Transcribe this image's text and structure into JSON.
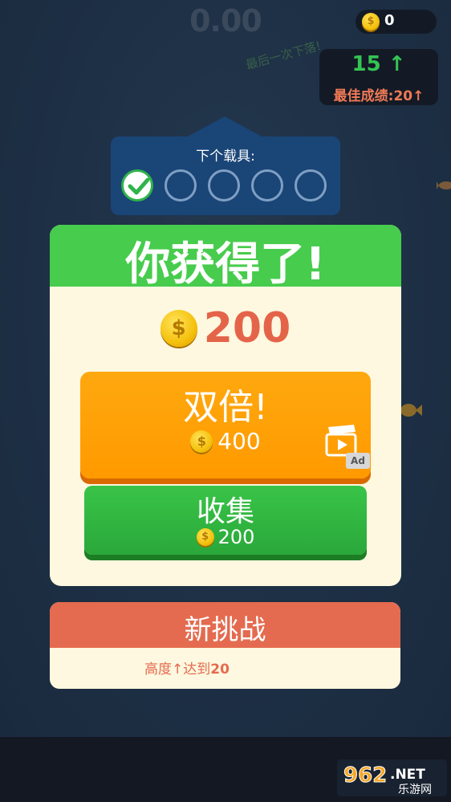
{
  "hud": {
    "score": "0.00",
    "coins": "0",
    "coin_symbol": "$",
    "current_height": "15 ↑",
    "best_label": "最佳成绩:",
    "best_value": "20↑"
  },
  "background_text": "最后一次下落!",
  "next_vehicle": {
    "title": "下个载具:",
    "progress": 1,
    "total": 5
  },
  "reward": {
    "title": "你获得了!",
    "amount": "200",
    "double_button": {
      "label": "双倍!",
      "amount": "400",
      "ad_badge": "Ad"
    },
    "collect_button": {
      "label": "收集",
      "amount": "200"
    }
  },
  "challenge": {
    "title": "新挑战",
    "desc_prefix": "高度↑达到",
    "desc_value": "20"
  },
  "watermark": {
    "top": "962",
    "top_suffix": ".NET",
    "bottom": "乐游网"
  },
  "colors": {
    "green": "#47cc4d",
    "orange": "#ff9a00",
    "red": "#e46b4f",
    "panel_bg": "#fdf8df",
    "navy": "#1a4577"
  }
}
